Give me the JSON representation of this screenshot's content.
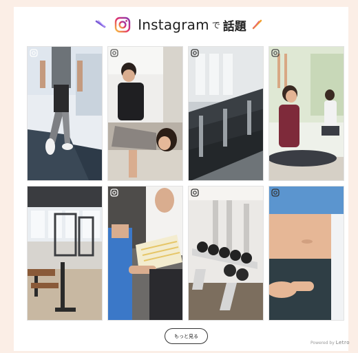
{
  "header": {
    "brand": "Instagram",
    "particle": "で",
    "topic": "話題"
  },
  "gallery": {
    "posts": [
      {
        "scene": "treadmill-runner",
        "has_badge": true
      },
      {
        "scene": "trainer-stretching",
        "has_badge": true
      },
      {
        "scene": "gym-equipment-row",
        "has_badge": true
      },
      {
        "scene": "yoga-pose",
        "has_badge": true
      },
      {
        "scene": "gym-interior-racks",
        "has_badge": false
      },
      {
        "scene": "trainer-clipboard",
        "has_badge": true
      },
      {
        "scene": "dumbbell-rack",
        "has_badge": true
      },
      {
        "scene": "waist-closeup",
        "has_badge": true
      }
    ]
  },
  "actions": {
    "more_label": "もっと見る"
  },
  "footer": {
    "powered_prefix": "Powered by",
    "powered_brand": "Letro"
  },
  "colors": {
    "background": "#fbeee6",
    "panel": "#ffffff",
    "ig_gradient": [
      "#f9c23c",
      "#e1306c",
      "#833ab4"
    ]
  }
}
